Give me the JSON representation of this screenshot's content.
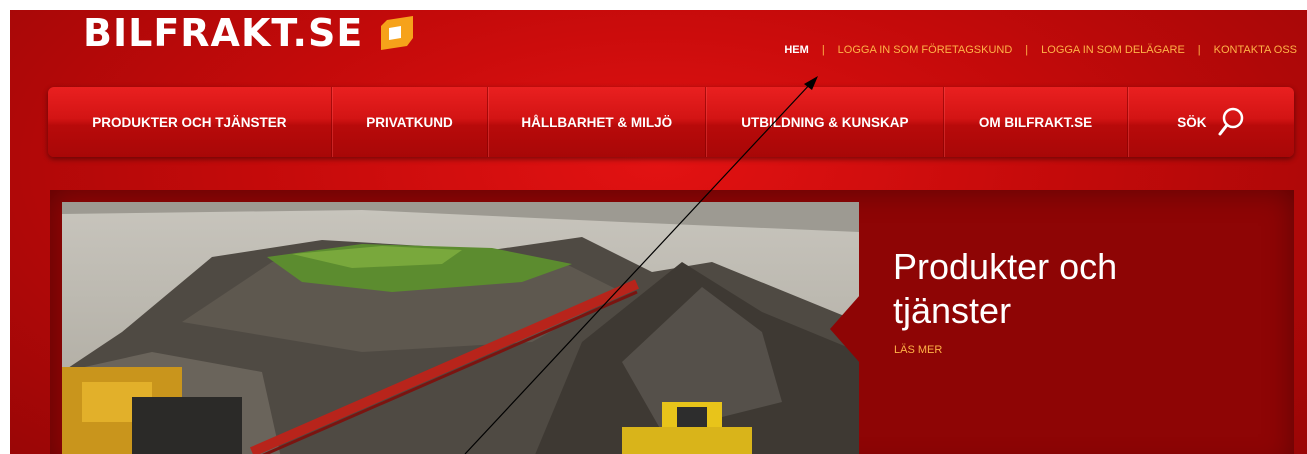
{
  "brand": {
    "logo_text": "BILFRAKT.SE"
  },
  "top_nav": [
    {
      "label": "HEM",
      "active": true
    },
    {
      "label": "LOGGA IN SOM FÖRETAGSKUND"
    },
    {
      "label": "LOGGA IN SOM DELÄGARE"
    },
    {
      "label": "KONTAKTA OSS"
    }
  ],
  "main_nav": [
    {
      "label": "PRODUKTER OCH TJÄNSTER"
    },
    {
      "label": "PRIVATKUND"
    },
    {
      "label": "HÅLLBARHET & MILJÖ"
    },
    {
      "label": "UTBILDNING & KUNSKAP"
    },
    {
      "label": "OM BILFRAKT.SE"
    },
    {
      "label": "SÖK",
      "icon": "search-icon"
    }
  ],
  "hero": {
    "title": "Produkter och tjänster",
    "link": "LÄS MER",
    "image": "gravel-pile-conveyor-photo"
  },
  "colors": {
    "primary_red": "#d31414",
    "dark_red": "#8e0505",
    "link_orange": "#ffb347",
    "logo_mark_orange": "#f6a21a"
  }
}
